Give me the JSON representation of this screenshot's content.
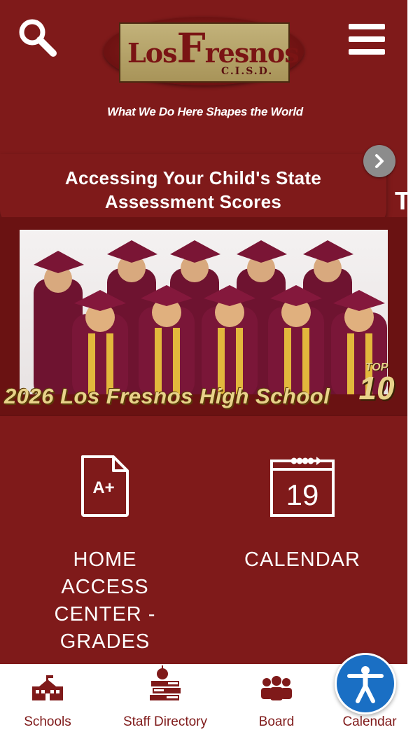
{
  "header": {
    "search_icon": "search-icon",
    "menu_icon": "hamburger-menu-icon",
    "logo": {
      "word_part1": "Los",
      "big_letter": "F",
      "word_part2": "resnos",
      "sub": "C.I.S.D.",
      "overlay_L": "L"
    },
    "tagline": "What We Do Here Shapes the World"
  },
  "announcement": {
    "text": "Accessing Your Child's State Assessment Scores",
    "next_icon": "chevron-right-icon",
    "ghost_tail": "T"
  },
  "banner": {
    "caption": "2026 Los Fresnos High School",
    "badge_top": "TOP",
    "badge_num": "10"
  },
  "quick_links": [
    {
      "label": "HOME ACCESS CENTER - GRADES",
      "icon": "grade-document-icon",
      "icon_text": "A+"
    },
    {
      "label": "CALENDAR",
      "icon": "calendar-icon",
      "icon_text": "19"
    }
  ],
  "bottom_nav": [
    {
      "label": "Schools",
      "icon": "school-building-icon"
    },
    {
      "label": "Staff Directory",
      "icon": "books-apple-icon"
    },
    {
      "label": "Board",
      "icon": "people-group-icon"
    },
    {
      "label": "Calendar",
      "icon": "calendar-icon"
    }
  ],
  "accessibility_icon": "accessibility-person-icon",
  "colors": {
    "maroon": "#7f1a1a",
    "gold": "#e8d28a",
    "accessibility_blue": "#1a6fc4"
  }
}
